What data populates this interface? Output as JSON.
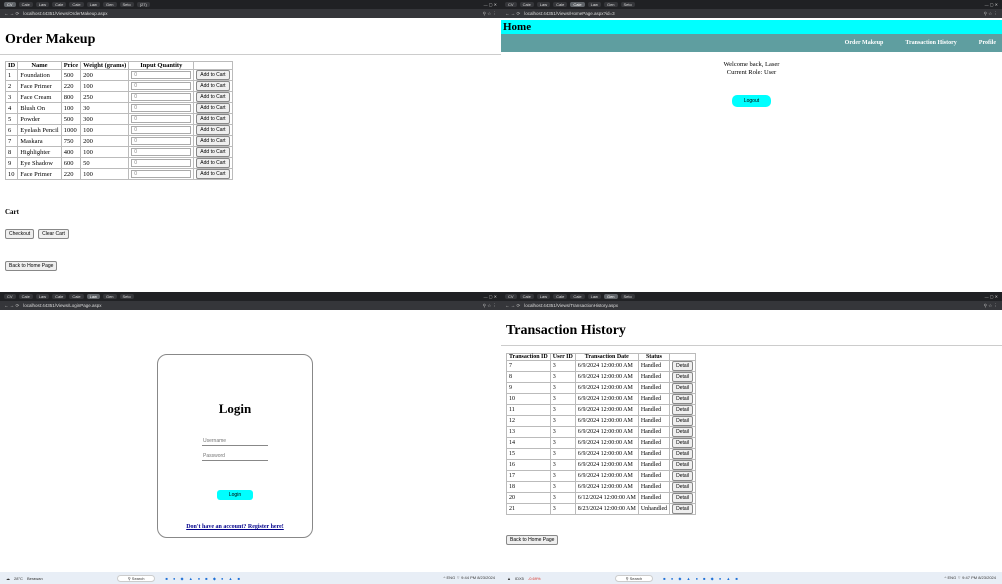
{
  "order": {
    "tabs": [
      "CV",
      "Cale",
      "Law",
      "Cale",
      "Cale",
      "Law",
      "Gen",
      "Seto",
      "(27)",
      "CV"
    ],
    "url": "localhost:44351/Views/OrderMakeup.aspx",
    "title": "Order Makeup",
    "columns": [
      "ID",
      "Name",
      "Price",
      "Weight (grams)",
      "Input Quantity",
      ""
    ],
    "rows": [
      {
        "id": "1",
        "name": "Foundation",
        "price": "500",
        "weight": "200"
      },
      {
        "id": "2",
        "name": "Face Primer",
        "price": "220",
        "weight": "100"
      },
      {
        "id": "3",
        "name": "Face Cream",
        "price": "800",
        "weight": "250"
      },
      {
        "id": "4",
        "name": "Blush On",
        "price": "100",
        "weight": "30"
      },
      {
        "id": "5",
        "name": "Powder",
        "price": "500",
        "weight": "300"
      },
      {
        "id": "6",
        "name": "Eyelash Pencil",
        "price": "1000",
        "weight": "100"
      },
      {
        "id": "7",
        "name": "Maskara",
        "price": "750",
        "weight": "200"
      },
      {
        "id": "8",
        "name": "Highlighter",
        "price": "400",
        "weight": "100"
      },
      {
        "id": "9",
        "name": "Eye Shadow",
        "price": "600",
        "weight": "50"
      },
      {
        "id": "10",
        "name": "Face Primer",
        "price": "220",
        "weight": "100"
      }
    ],
    "qty_value": "0",
    "add_label": "Add to Cart",
    "cart_heading": "Cart",
    "checkout_label": "Checkout",
    "clear_label": "Clear Cart",
    "back_label": "Back to Home Page"
  },
  "home": {
    "url": "localhost:44351/Views/HomePage.aspx?id=3",
    "title": "Home",
    "nav": [
      "Order Makeup",
      "Transaction History",
      "Profile"
    ],
    "welcome": "Welcome back, Laser",
    "role": "Current Role: User",
    "logout_label": "Logout"
  },
  "login": {
    "url": "localhost:44351/Views/LoginPage.aspx",
    "title": "Login",
    "username_placeholder": "Username",
    "password_placeholder": "Password",
    "login_label": "Login",
    "register_link": "Don't have an account? Register here!"
  },
  "history": {
    "url": "localhost:44351/Views/TransactionHistory.aspx",
    "title": "Transaction History",
    "columns": [
      "Transaction ID",
      "User ID",
      "Transaction Date",
      "Status",
      ""
    ],
    "rows": [
      {
        "tid": "7",
        "uid": "3",
        "date": "6/9/2024 12:00:00 AM",
        "status": "Handled"
      },
      {
        "tid": "8",
        "uid": "3",
        "date": "6/9/2024 12:00:00 AM",
        "status": "Handled"
      },
      {
        "tid": "9",
        "uid": "3",
        "date": "6/9/2024 12:00:00 AM",
        "status": "Handled"
      },
      {
        "tid": "10",
        "uid": "3",
        "date": "6/9/2024 12:00:00 AM",
        "status": "Handled"
      },
      {
        "tid": "11",
        "uid": "3",
        "date": "6/9/2024 12:00:00 AM",
        "status": "Handled"
      },
      {
        "tid": "12",
        "uid": "3",
        "date": "6/9/2024 12:00:00 AM",
        "status": "Handled"
      },
      {
        "tid": "13",
        "uid": "3",
        "date": "6/9/2024 12:00:00 AM",
        "status": "Handled"
      },
      {
        "tid": "14",
        "uid": "3",
        "date": "6/9/2024 12:00:00 AM",
        "status": "Handled"
      },
      {
        "tid": "15",
        "uid": "3",
        "date": "6/9/2024 12:00:00 AM",
        "status": "Handled"
      },
      {
        "tid": "16",
        "uid": "3",
        "date": "6/9/2024 12:00:00 AM",
        "status": "Handled"
      },
      {
        "tid": "17",
        "uid": "3",
        "date": "6/9/2024 12:00:00 AM",
        "status": "Handled"
      },
      {
        "tid": "18",
        "uid": "3",
        "date": "6/9/2024 12:00:00 AM",
        "status": "Handled"
      },
      {
        "tid": "20",
        "uid": "3",
        "date": "6/12/2024 12:00:00 AM",
        "status": "Handled"
      },
      {
        "tid": "21",
        "uid": "3",
        "date": "8/23/2024 12:00:00 AM",
        "status": "Unhandled"
      }
    ],
    "detail_label": "Detail",
    "back_label": "Back to Home Page"
  },
  "taskbar": {
    "weather_left": "28°C",
    "weather_left_sub": "Berawan",
    "weather_right": "IDX5",
    "weather_right_sub": "-0.69%",
    "search": "Search",
    "lang": "ENG",
    "time_login": "9:44 PM",
    "date_login": "8/23/2024",
    "time_history": "9:47 PM",
    "date_history": "8/23/2024"
  },
  "colors": {
    "accent_cyan": "#00ffff",
    "nav_teal": "#5f9ea0",
    "link_blue": "#00008b"
  }
}
